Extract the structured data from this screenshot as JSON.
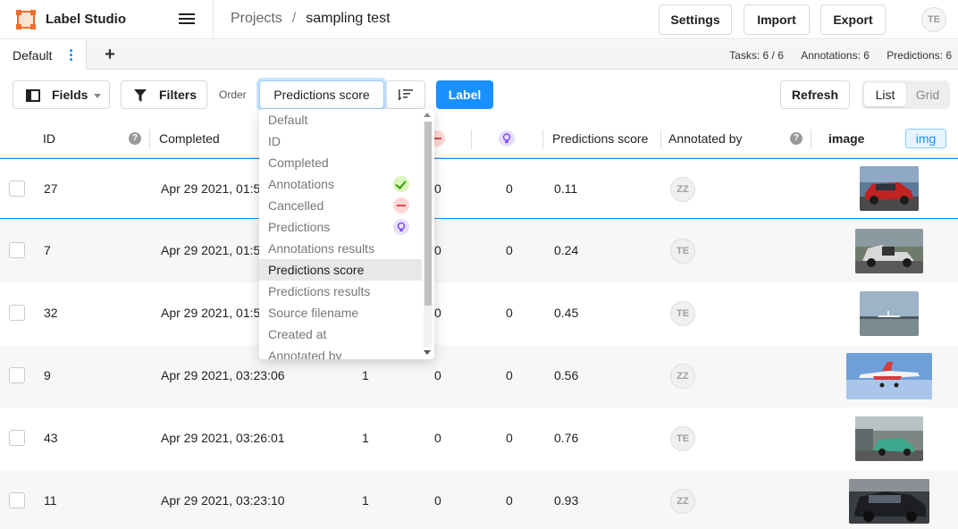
{
  "app": {
    "name": "Label Studio"
  },
  "breadcrumb": {
    "projects": "Projects",
    "separator": "/",
    "current": "sampling test"
  },
  "header": {
    "settings": "Settings",
    "import": "Import",
    "export": "Export",
    "user_initials": "TE"
  },
  "tabs": {
    "active": "Default",
    "add": "+"
  },
  "stats": {
    "tasks": "Tasks: 6 / 6",
    "annotations": "Annotations: 6",
    "predictions": "Predictions: 6"
  },
  "toolbar": {
    "fields": "Fields",
    "filters": "Filters",
    "order_label": "Order",
    "order_value": "Predictions score",
    "label": "Label",
    "refresh": "Refresh",
    "view_list": "List",
    "view_grid": "Grid"
  },
  "columns": {
    "id": "ID",
    "completed": "Completed",
    "predictions_score": "Predictions score",
    "annotated_by": "Annotated by",
    "image": "image",
    "image_tag": "img"
  },
  "order_options": [
    "Default",
    "ID",
    "Completed",
    "Annotations",
    "Cancelled",
    "Predictions",
    "Annotations results",
    "Predictions score",
    "Predictions results",
    "Source filename",
    "Created at",
    "Annotated by"
  ],
  "order_selected_index": 7,
  "rows": [
    {
      "id": "27",
      "completed": "Apr 29 2021, 01:5",
      "annotations": "",
      "cancelled": "0",
      "predictions": "0",
      "score": "0.11",
      "annotator": "ZZ"
    },
    {
      "id": "7",
      "completed": "Apr 29 2021, 01:5",
      "annotations": "",
      "cancelled": "0",
      "predictions": "0",
      "score": "0.24",
      "annotator": "TE"
    },
    {
      "id": "32",
      "completed": "Apr 29 2021, 01:5",
      "annotations": "",
      "cancelled": "0",
      "predictions": "0",
      "score": "0.45",
      "annotator": "TE"
    },
    {
      "id": "9",
      "completed": "Apr 29 2021, 03:23:06",
      "annotations": "1",
      "cancelled": "0",
      "predictions": "0",
      "score": "0.56",
      "annotator": "ZZ"
    },
    {
      "id": "43",
      "completed": "Apr 29 2021, 03:26:01",
      "annotations": "1",
      "cancelled": "0",
      "predictions": "0",
      "score": "0.76",
      "annotator": "TE"
    },
    {
      "id": "11",
      "completed": "Apr 29 2021, 03:23:10",
      "annotations": "1",
      "cancelled": "0",
      "predictions": "0",
      "score": "0.93",
      "annotator": "ZZ"
    }
  ],
  "colors": {
    "accent": "#1890ff",
    "logo": "#f06d2a"
  }
}
